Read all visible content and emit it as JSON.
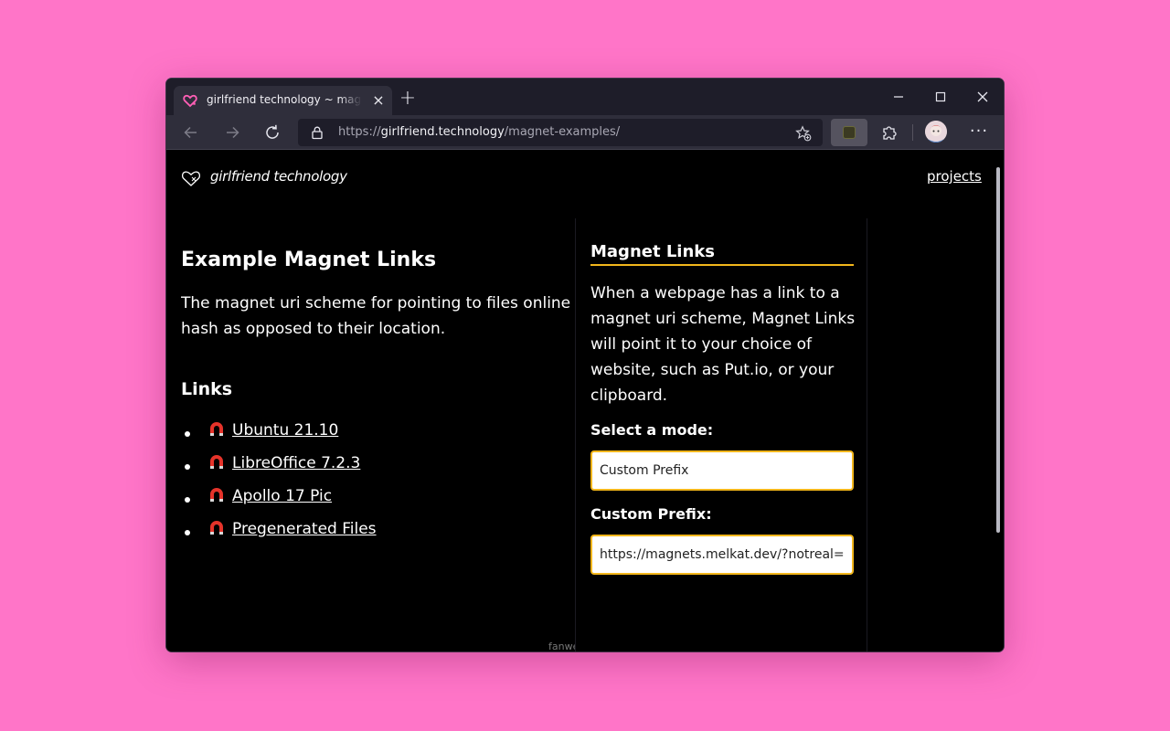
{
  "browser": {
    "tab_title": "girlfriend technology ~ magnet examples",
    "tab_close": "×",
    "new_tab": "+",
    "url_scheme": "https://",
    "url_host": "girlfriend.technology",
    "url_path": "/magnet-examples/",
    "menu": "···"
  },
  "site": {
    "name": "girlfriend technology",
    "nav_link": "projects"
  },
  "page": {
    "heading": "Example Magnet Links",
    "intro_line1": "The magnet uri scheme for pointing to files online by their",
    "intro_line2": "hash as opposed to their location.",
    "links_heading": "Links",
    "links": [
      {
        "label": "Ubuntu 21.10"
      },
      {
        "label": "LibreOffice 7.2.3"
      },
      {
        "label": "Apollo 17 Pic"
      },
      {
        "label": "Pregenerated Files"
      }
    ],
    "footer": "fanwebsite"
  },
  "popup": {
    "title": "Magnet Links",
    "description": "When a webpage has a link to a magnet uri scheme, Magnet Links will point it to your choice of website, such as Put.io, or your clipboard.",
    "mode_label": "Select a mode:",
    "mode_value": "Custom Prefix",
    "prefix_label": "Custom Prefix:",
    "prefix_value": "https://magnets.melkat.dev/?notreal="
  },
  "colors": {
    "background": "#ff75c8",
    "accent": "#f2b61b",
    "magnet_red": "#e5332a"
  }
}
